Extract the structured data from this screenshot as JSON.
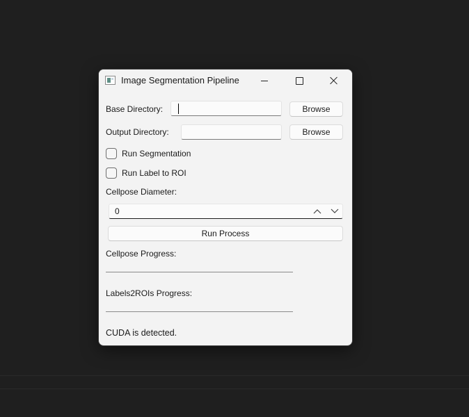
{
  "window": {
    "title": "Image Segmentation Pipeline"
  },
  "base_directory": {
    "label": "Base Directory:",
    "value": "",
    "browse_label": "Browse"
  },
  "output_directory": {
    "label": "Output Directory:",
    "value": "",
    "browse_label": "Browse"
  },
  "options": {
    "run_segmentation": {
      "label": "Run Segmentation",
      "checked": false
    },
    "run_label_to_roi": {
      "label": "Run Label to ROI",
      "checked": false
    }
  },
  "cellpose": {
    "diameter_label": "Cellpose Diameter:",
    "diameter_value": "0"
  },
  "run_button": "Run Process",
  "progress": {
    "cellpose_label": "Cellpose Progress:",
    "cellpose_value": 0,
    "labels2rois_label": "Labels2ROIs Progress:",
    "labels2rois_value": 0
  },
  "status": "CUDA is detected."
}
